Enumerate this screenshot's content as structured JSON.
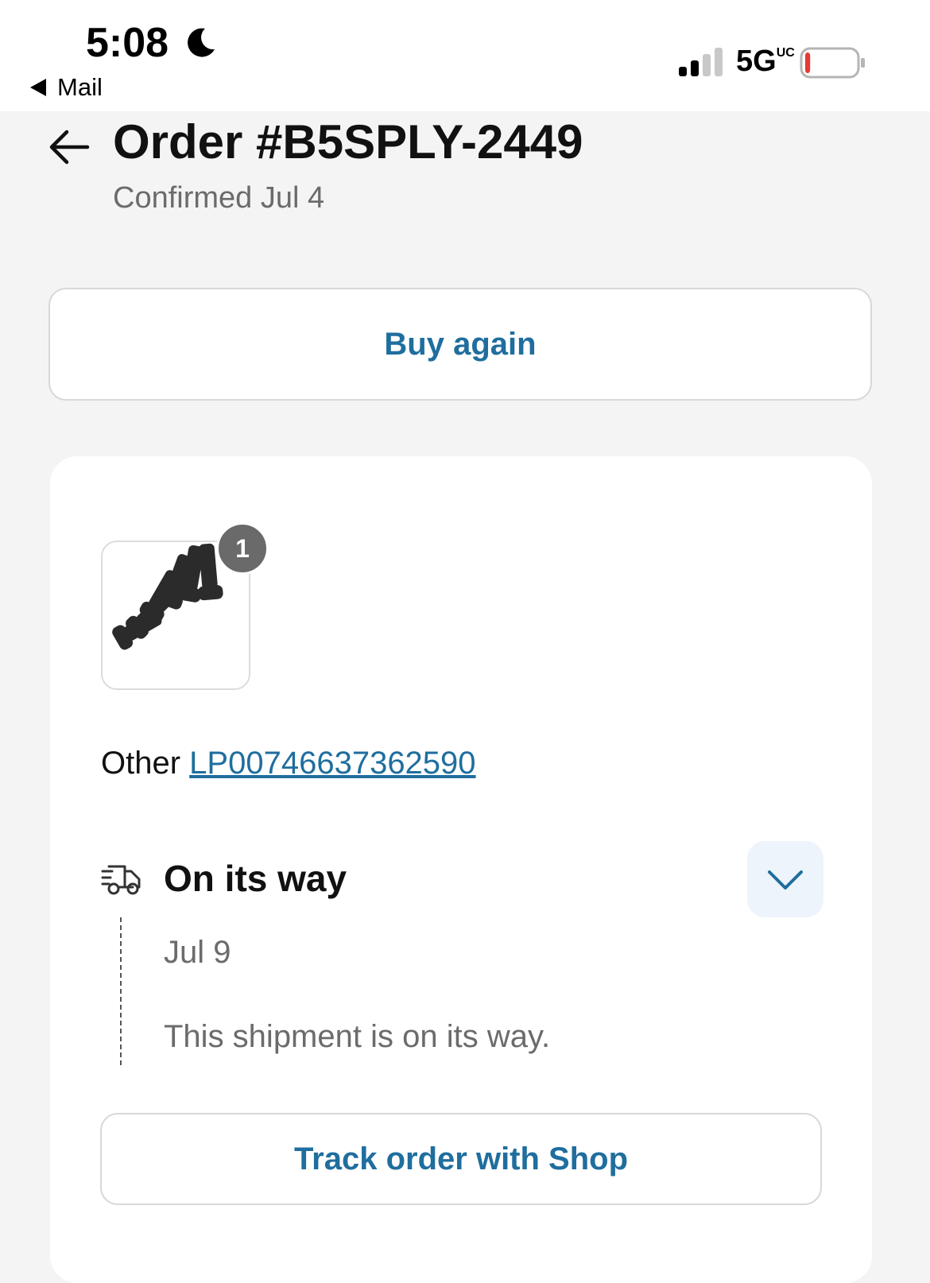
{
  "status_bar": {
    "time": "5:08",
    "back_app": "Mail",
    "network": "5G",
    "network_suffix": "UC",
    "icons": [
      "moon-icon",
      "signal-icon",
      "battery-icon"
    ],
    "battery_level": 0.1
  },
  "header": {
    "title": "Order #B5SPLY-2449",
    "subtitle": "Confirmed Jul 4"
  },
  "actions": {
    "buy_again": "Buy again"
  },
  "shipment": {
    "item_quantity": "1",
    "carrier_label": "Other",
    "tracking_number": "LP00746637362590",
    "status": "On its way",
    "event_date": "Jul 9",
    "event_description": "This shipment is on its way.",
    "track_button": "Track order with Shop"
  },
  "colors": {
    "accent": "#1f6e9e",
    "background": "#f4f4f4",
    "muted_text": "#6b6b6b",
    "battery_low": "#e53935"
  }
}
